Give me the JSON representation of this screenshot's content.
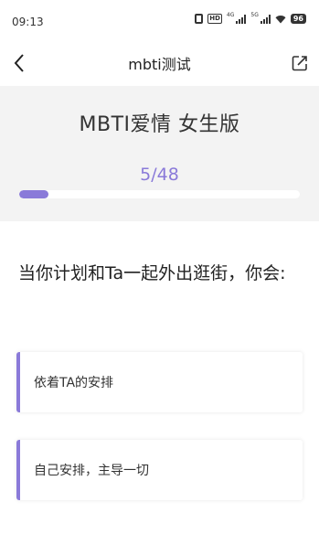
{
  "status_bar": {
    "time": "09:13",
    "hd_label": "HD",
    "signal1_label": "4G",
    "signal2_label": "5G",
    "battery": "96"
  },
  "nav": {
    "title": "mbti测试",
    "back_icon": "chevron-left-icon",
    "share_icon": "share-icon"
  },
  "test": {
    "title": "MBTI爱情 女生版",
    "progress_text": "5/48",
    "progress_fraction": 0.104,
    "accent_color": "#8a7ad9"
  },
  "question": {
    "text": "当你计划和Ta一起外出逛街，你会:",
    "options": [
      "依着TA的安排",
      "自己安排，主导一切"
    ]
  }
}
